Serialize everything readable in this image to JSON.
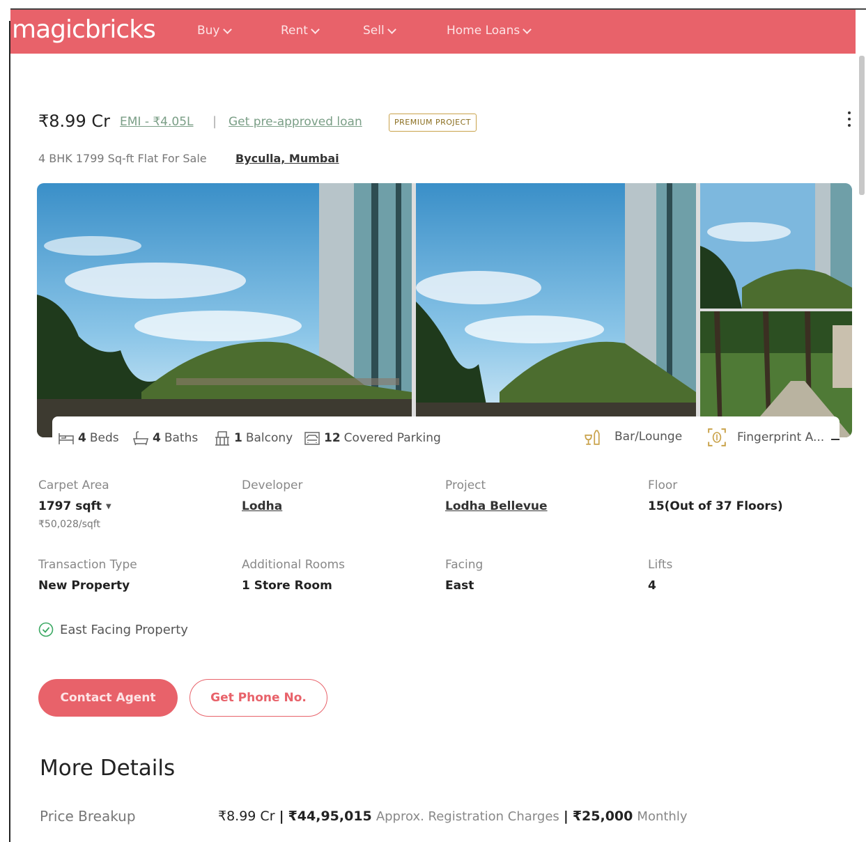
{
  "header": {
    "logo": "magicbricks",
    "nav": [
      {
        "label": "Buy"
      },
      {
        "label": "Rent"
      },
      {
        "label": "Sell"
      },
      {
        "label": "Home Loans"
      }
    ]
  },
  "listing": {
    "price": "₹8.99 Cr",
    "emi": "EMI - ₹4.05L",
    "separator": "|",
    "loan_link": "Get pre-approved loan",
    "badge": "PREMIUM PROJECT",
    "subtitle": "4 BHK 1799 Sq-ft Flat For Sale",
    "locality": "Byculla, Mumbai"
  },
  "amenities": {
    "beds_count": "4",
    "beds_label": "Beds",
    "baths_count": "4",
    "baths_label": "Baths",
    "balcony_count": "1",
    "balcony_label": "Balcony",
    "parking_count": "12",
    "parking_label": "Covered Parking",
    "bar": "Bar/Lounge",
    "fingerprint": "Fingerprint A..."
  },
  "details": {
    "carpet_label": "Carpet Area",
    "carpet_value": "1797 sqft",
    "carpet_rate": "₹50,028/sqft",
    "developer_label": "Developer",
    "developer_value": "Lodha",
    "project_label": "Project",
    "project_value": "Lodha Bellevue",
    "floor_label": "Floor",
    "floor_value": "15(Out of 37 Floors)",
    "transaction_label": "Transaction Type",
    "transaction_value": "New Property",
    "rooms_label": "Additional Rooms",
    "rooms_value": "1 Store Room",
    "facing_label": "Facing",
    "facing_value": "East",
    "lifts_label": "Lifts",
    "lifts_value": "4"
  },
  "highlight": "East Facing Property",
  "actions": {
    "contact": "Contact Agent",
    "phone": "Get Phone No."
  },
  "more": {
    "title": "More Details",
    "price_breakup_label": "Price Breakup",
    "pb_price": "₹8.99 Cr",
    "pb_sep1": "|",
    "pb_registration_amount": "₹44,95,015",
    "pb_registration_text": "Approx. Registration Charges",
    "pb_sep2": "|",
    "pb_maintenance_amount": "₹25,000",
    "pb_maintenance_text": "Monthly"
  },
  "colors": {
    "brand": "#e8626a",
    "link_green": "#7a9e86",
    "badge_gold": "#c9a24a"
  }
}
